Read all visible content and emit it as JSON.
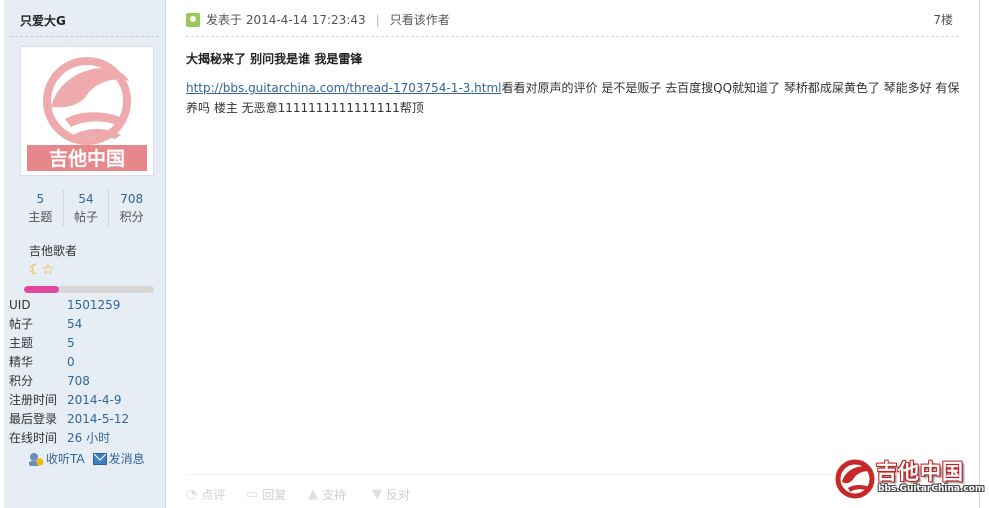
{
  "user": {
    "name": "只爱大G",
    "avatar_text": "吉他中国",
    "stats": [
      {
        "value": "5",
        "label": "主题"
      },
      {
        "value": "54",
        "label": "帖子"
      },
      {
        "value": "708",
        "label": "积分"
      }
    ],
    "rank_title": "吉他歌者",
    "rank_progress": 0.27,
    "info": [
      {
        "key": "UID",
        "value": "1501259"
      },
      {
        "key": "帖子",
        "value": "54"
      },
      {
        "key": "主题",
        "value": "5"
      },
      {
        "key": "精华",
        "value": "0"
      },
      {
        "key": "积分",
        "value": "708"
      },
      {
        "key": "注册时间",
        "value": "2014-4-9"
      },
      {
        "key": "最后登录",
        "value": "2014-5-12"
      },
      {
        "key": "在线时间",
        "value": "26 小时"
      }
    ],
    "follow_label": "收听TA",
    "message_label": "发消息"
  },
  "post": {
    "posted_at": "发表于 2014-4-14 17:23:43",
    "author_only": "只看该作者",
    "floor": "7楼",
    "title": "大揭秘来了 别问我是谁 我是雷锋",
    "link_text": "http://bbs.guitarchina.com/thread-1703754-1-3.html",
    "body_text": "看看对原声的评价  是不是贩子 去百度搜QQ就知道了  琴桥都成屎黄色了 琴能多好 有保养吗 楼主  无恶意1111111111111111帮顶",
    "actions": [
      {
        "label": "点评",
        "icon": "comment-icon"
      },
      {
        "label": "回复",
        "icon": "reply-icon"
      },
      {
        "label": "支持",
        "icon": "thumbs-up-icon"
      },
      {
        "label": "反对",
        "icon": "thumbs-down-icon"
      }
    ]
  },
  "watermark": {
    "title": "吉他中国",
    "url": "bbs.GuitarChina.com"
  },
  "colors": {
    "sidebar_bg": "#e6edf4",
    "link": "#336699",
    "progress": "#e0489d",
    "avatar_red": "#e0585f"
  }
}
